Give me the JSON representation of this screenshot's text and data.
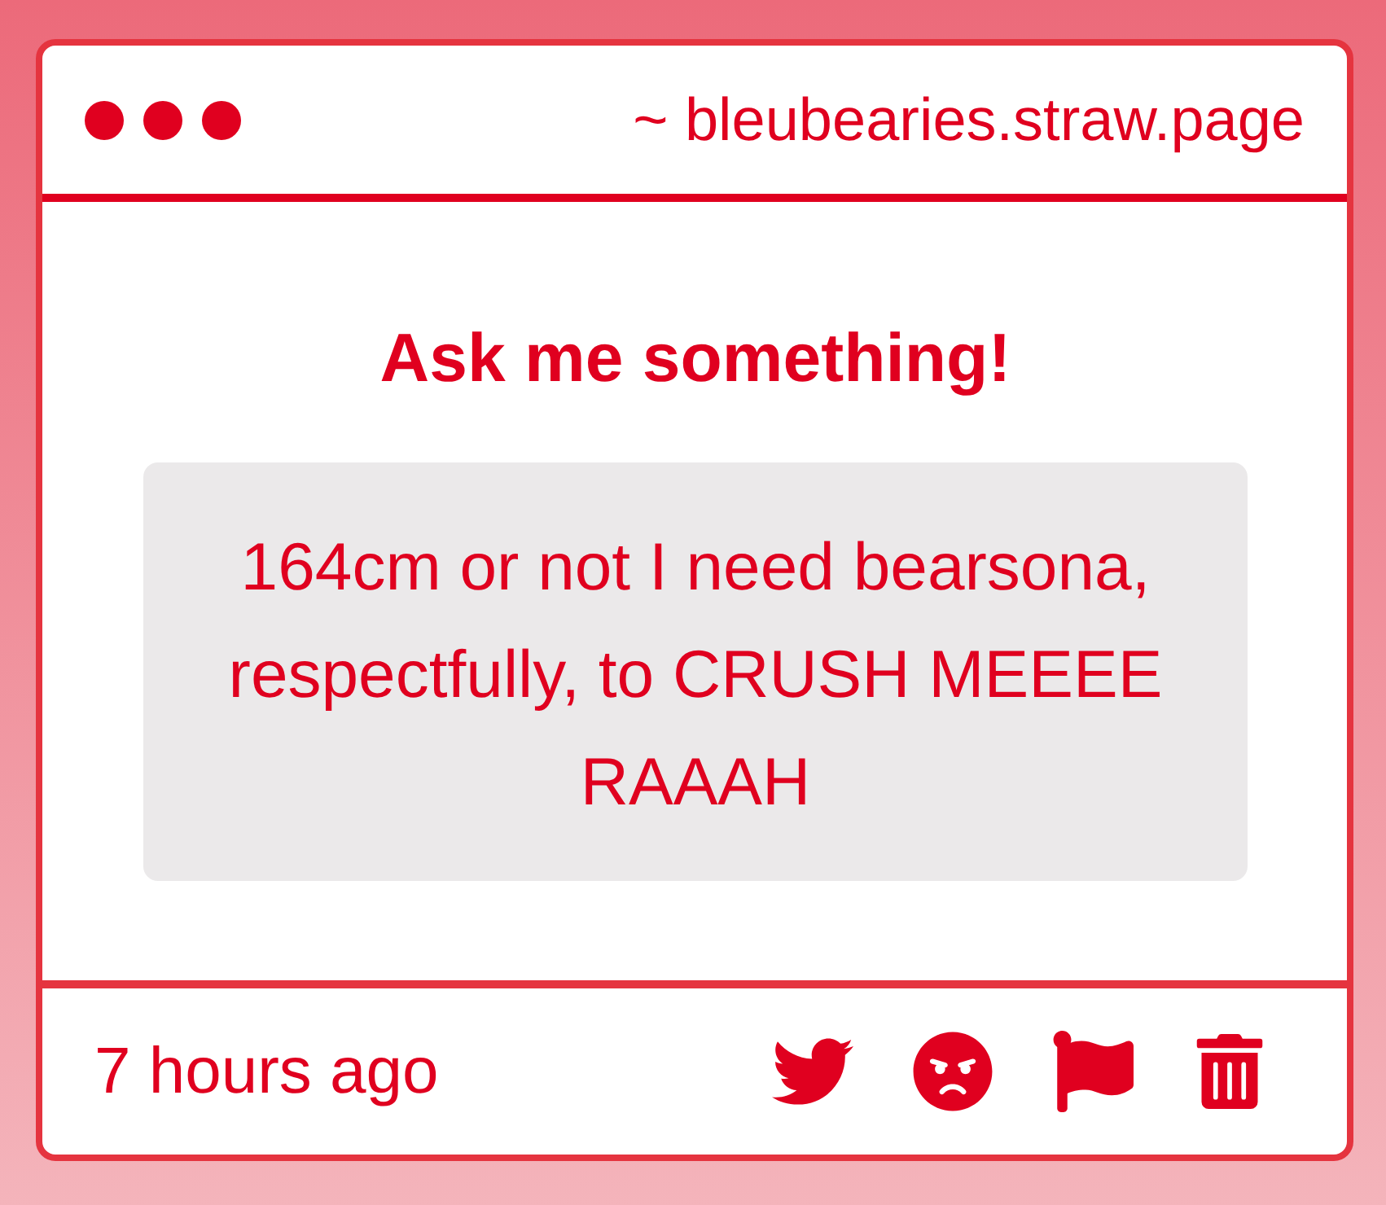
{
  "window": {
    "url": "~ bleubearies.straw.page"
  },
  "prompt": "Ask me something!",
  "question": "164cm or not I need bearsona, respectfully, to CRUSH MEEEE RAAAH",
  "footer": {
    "time": "7 hours ago",
    "actions": [
      {
        "kind": "share"
      },
      {
        "kind": "react"
      },
      {
        "kind": "report"
      },
      {
        "kind": "delete"
      }
    ]
  }
}
